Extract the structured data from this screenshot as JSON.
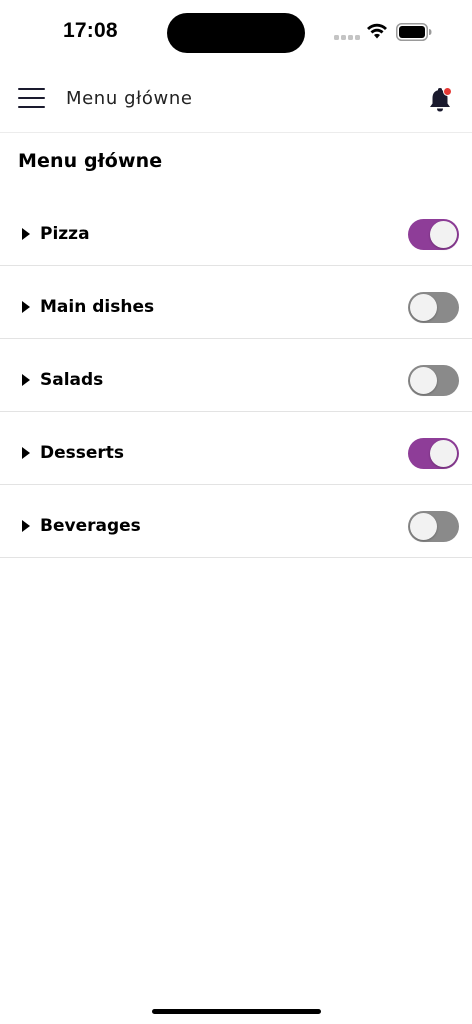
{
  "status_bar": {
    "time": "17:08",
    "icons": [
      "cellular-signal-icon",
      "wifi-icon",
      "battery-icon"
    ]
  },
  "app_bar": {
    "menu_icon": "hamburger-menu-icon",
    "title": "Menu główne",
    "notification_icon": "bell-icon",
    "notification_badge": true
  },
  "page": {
    "title": "Menu główne"
  },
  "categories": [
    {
      "label": "Pizza",
      "enabled": true
    },
    {
      "label": "Main dishes",
      "enabled": false
    },
    {
      "label": "Salads",
      "enabled": false
    },
    {
      "label": "Desserts",
      "enabled": true
    },
    {
      "label": "Beverages",
      "enabled": false
    }
  ],
  "colors": {
    "accent": "#8e3d98",
    "toggle_off": "#8a8a8a",
    "badge": "#e53935",
    "icon_dark": "#1a1a2e"
  }
}
